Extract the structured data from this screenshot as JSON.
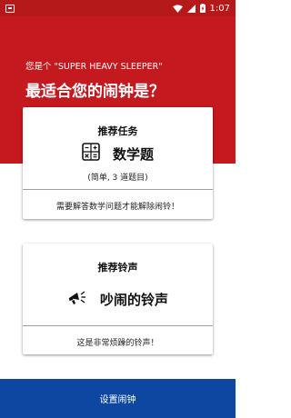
{
  "status_bar": {
    "time": "1:07",
    "icons": [
      "notification-icon",
      "wifi-icon",
      "cellular-signal-icon",
      "battery-charging-icon"
    ]
  },
  "header": {
    "subtitle": "您是个 \"SUPER HEAVY SLEEPER\"",
    "title": "最适合您的闹钟是？"
  },
  "task_card": {
    "title": "推荐任务",
    "icon": "calculator-icon",
    "main_label": "数学题",
    "note": "(简单, 3 道题目)",
    "footer": "需要解答数学问题才能解除闹铃！"
  },
  "ringtone_card": {
    "title": "推荐铃声",
    "icon": "megaphone-icon",
    "main_label": "吵闹的铃声",
    "footer": "这是非常烦躁的铃声！"
  },
  "action": {
    "label": "设置闹钟"
  },
  "colors": {
    "primary_red": "#c4191f",
    "status_bar_red": "#b51919",
    "button_blue": "#0d47a1"
  }
}
